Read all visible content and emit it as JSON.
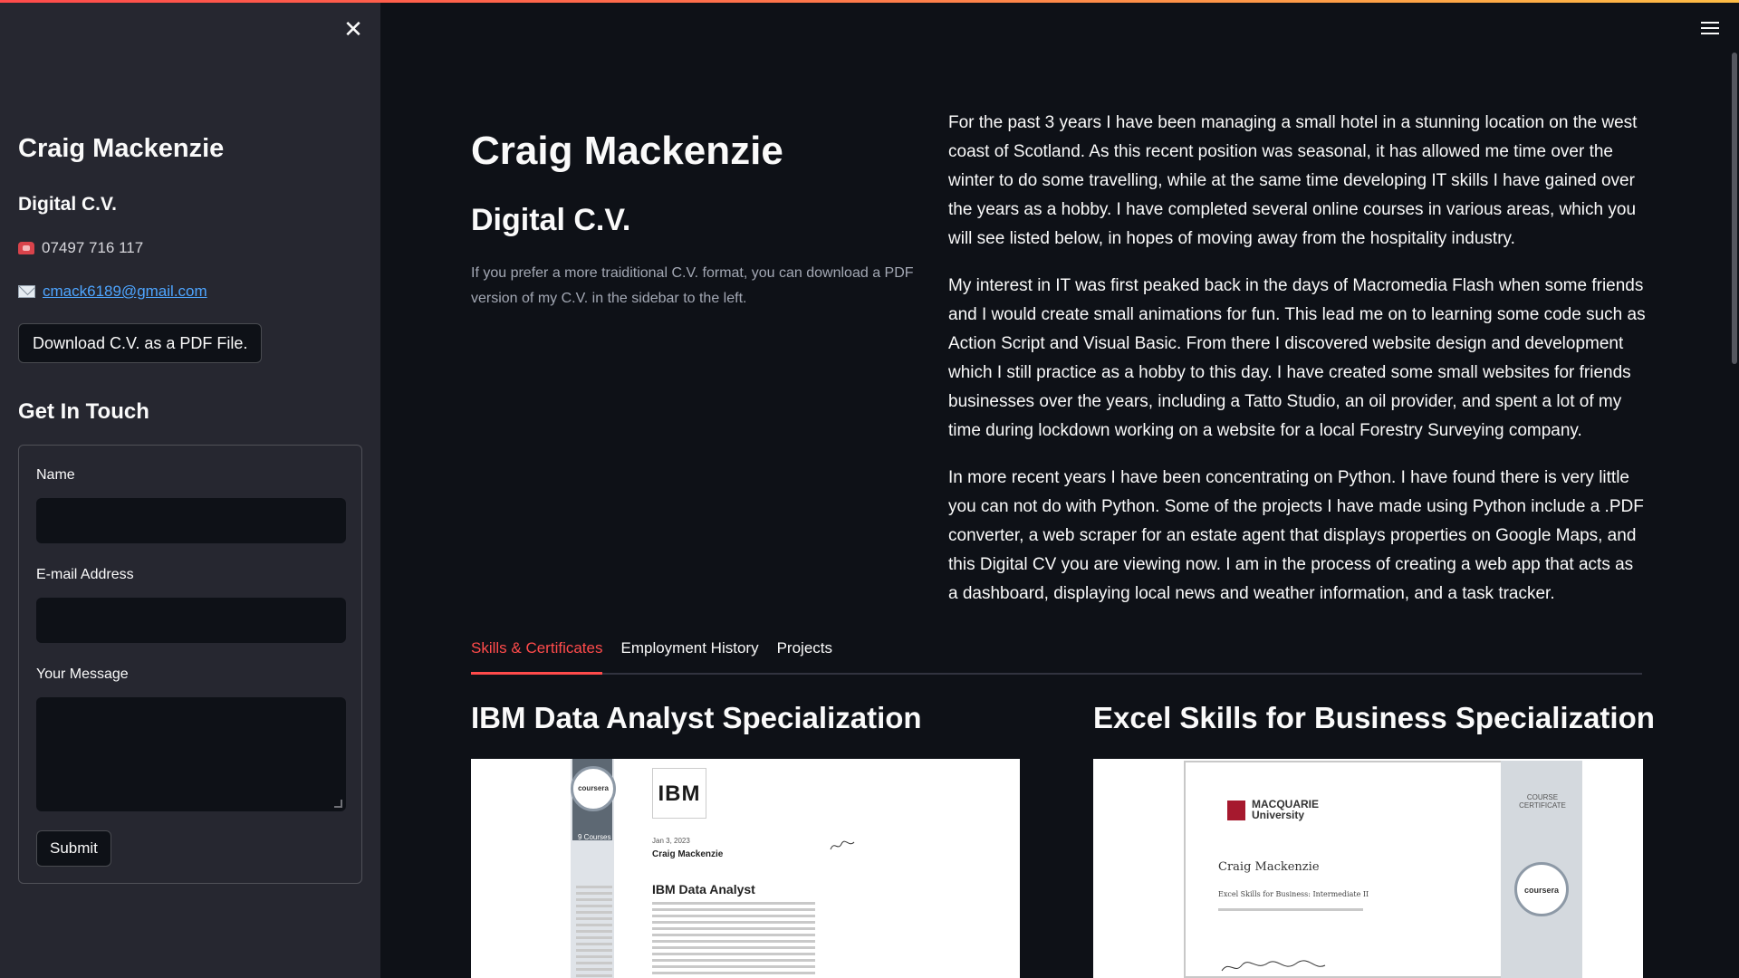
{
  "sidebar": {
    "close_icon": "close-icon",
    "name": "Craig Mackenzie",
    "subtitle": "Digital C.V.",
    "phone": "07497 716 117",
    "email": "cmack6189@gmail.com",
    "download_button": "Download C.V. as a PDF File.",
    "contact_heading": "Get In Touch",
    "form": {
      "name_label": "Name",
      "name_value": "",
      "email_label": "E-mail Address",
      "email_value": "",
      "message_label": "Your Message",
      "message_value": "",
      "submit_label": "Submit"
    }
  },
  "header": {
    "menu_icon": "hamburger-menu-icon"
  },
  "main": {
    "title": "Craig Mackenzie",
    "subtitle": "Digital C.V.",
    "note": "If you prefer a more traiditional C.V. format, you can download a PDF version of my C.V. in the sidebar to the left.",
    "bio": [
      "For the past 3 years I have been managing a small hotel in a stunning location on the west coast of Scotland. As this recent position was seasonal, it has allowed me time over the winter to do some travelling, while at the same time developing IT skills I have gained over the years as a hobby. I have completed several online courses in various areas, which you will see listed below, in hopes of moving away from the hospitality industry.",
      "My interest in IT was first peaked back in the days of Macromedia Flash when some friends and I would create small animations for fun. This lead me on to learning some code such as Action Script and Visual Basic. From there I discovered website design and development which I still practice as a hobby to this day. I have created some small websites for friends businesses over the years, including a Tatto Studio, an oil provider, and spent a lot of my time during lockdown working on a website for a local Forestry Surveying company.",
      "In more recent years I have been concentrating on Python. I have found there is very little you can not do with Python. Some of the projects I have made using Python include a .PDF converter, a web scraper for an estate agent that displays properties on Google Maps, and this Digital CV you are viewing now. I am in the process of creating a web app that acts as a dashboard, displaying local news and weather information, and a task tracker."
    ],
    "tabs": [
      {
        "label": "Skills & Certificates",
        "active": true
      },
      {
        "label": "Employment History",
        "active": false
      },
      {
        "label": "Projects",
        "active": false
      }
    ],
    "certificates": [
      {
        "title": "IBM Data Analyst Specialization",
        "image": {
          "seal": "coursera",
          "courses": "9 Courses",
          "logo": "IBM",
          "date": "Jan 3, 2023",
          "holder": "Craig Mackenzie",
          "course": "IBM Data Analyst"
        }
      },
      {
        "title": "Excel Skills for Business Specialization",
        "image": {
          "institution": "MACQUARIE University",
          "ribbon": "COURSE CERTIFICATE",
          "seal": "coursera",
          "holder": "Craig Mackenzie",
          "course": "Excel Skills for Business: Intermediate II"
        }
      }
    ]
  },
  "colors": {
    "background": "#0e1117",
    "sidebar": "#262730",
    "accent": "#ff4b4b",
    "link": "#4ea5ff"
  }
}
